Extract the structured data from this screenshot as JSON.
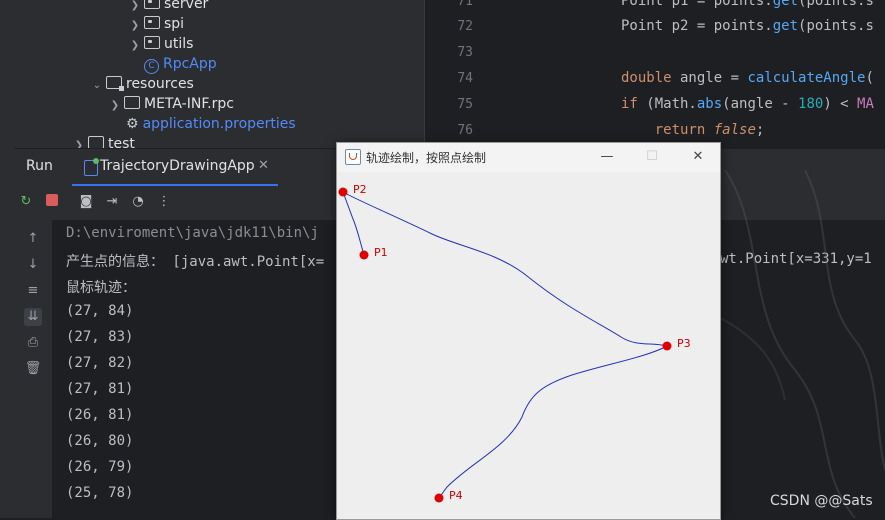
{
  "project_tree": {
    "items": [
      {
        "label": "server",
        "type": "package"
      },
      {
        "label": "spi",
        "type": "package"
      },
      {
        "label": "utils",
        "type": "package"
      },
      {
        "label": "RpcApp",
        "type": "class"
      },
      {
        "label": "resources",
        "type": "resources"
      },
      {
        "label": "META-INF.rpc",
        "type": "folder"
      },
      {
        "label": "application.properties",
        "type": "properties"
      },
      {
        "label": "test",
        "type": "folder"
      }
    ]
  },
  "editor": {
    "line_numbers": [
      "71",
      "72",
      "73",
      "74",
      "75",
      "76"
    ]
  },
  "run_panel": {
    "label": "Run",
    "tab_title": "TrajectoryDrawingApp",
    "console_lines": [
      "D:\\enviroment\\java\\jdk11\\bin\\j",
      "产生点的信息： [java.awt.Point[x=",
      "鼠标轨迹：",
      "(27, 84)",
      "(27, 83)",
      "(27, 82)",
      "(27, 81)",
      "(26, 81)",
      "(26, 80)",
      "(26, 79)",
      "(25, 78)"
    ],
    "console_tail": "wt.Point[x=331,y=1"
  },
  "swing_window": {
    "title": "轨迹绘制，按照点绘制",
    "minimize": "—",
    "maximize": "☐",
    "close": "✕",
    "points": [
      {
        "label": "P1"
      },
      {
        "label": "P2"
      },
      {
        "label": "P3"
      },
      {
        "label": "P4"
      }
    ],
    "colors": {
      "point": "#e00000",
      "path": "#2233bb",
      "label": "#cc0000"
    }
  },
  "watermark": "CSDN @@Sats"
}
